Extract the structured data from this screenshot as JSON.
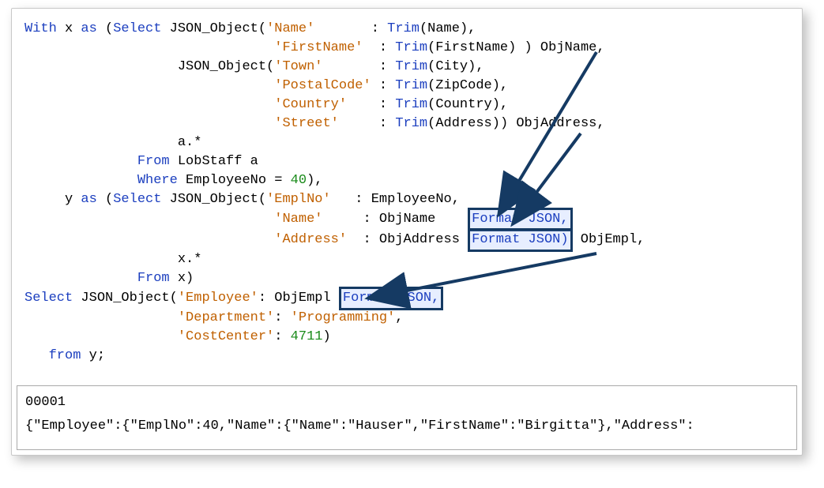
{
  "code": {
    "lines": [
      [
        {
          "c": "kw",
          "t": "With"
        },
        {
          "c": "txt",
          "t": " x "
        },
        {
          "c": "kw",
          "t": "as"
        },
        {
          "c": "txt",
          "t": " ("
        },
        {
          "c": "kw",
          "t": "Select"
        },
        {
          "c": "txt",
          "t": " JSON_Object("
        },
        {
          "c": "str",
          "t": "'Name'"
        },
        {
          "c": "txt",
          "t": "       : "
        },
        {
          "c": "kw",
          "t": "Trim"
        },
        {
          "c": "txt",
          "t": "(Name),"
        }
      ],
      [
        {
          "c": "txt",
          "t": "                               "
        },
        {
          "c": "str",
          "t": "'FirstName'"
        },
        {
          "c": "txt",
          "t": "  : "
        },
        {
          "c": "kw",
          "t": "Trim"
        },
        {
          "c": "txt",
          "t": "(FirstName) ) ObjName,"
        }
      ],
      [
        {
          "c": "txt",
          "t": "                   JSON_Object("
        },
        {
          "c": "str",
          "t": "'Town'"
        },
        {
          "c": "txt",
          "t": "       : "
        },
        {
          "c": "kw",
          "t": "Trim"
        },
        {
          "c": "txt",
          "t": "(City),"
        }
      ],
      [
        {
          "c": "txt",
          "t": "                               "
        },
        {
          "c": "str",
          "t": "'PostalCode'"
        },
        {
          "c": "txt",
          "t": " : "
        },
        {
          "c": "kw",
          "t": "Trim"
        },
        {
          "c": "txt",
          "t": "(ZipCode),"
        }
      ],
      [
        {
          "c": "txt",
          "t": "                               "
        },
        {
          "c": "str",
          "t": "'Country'"
        },
        {
          "c": "txt",
          "t": "    : "
        },
        {
          "c": "kw",
          "t": "Trim"
        },
        {
          "c": "txt",
          "t": "(Country),"
        }
      ],
      [
        {
          "c": "txt",
          "t": "                               "
        },
        {
          "c": "str",
          "t": "'Street'"
        },
        {
          "c": "txt",
          "t": "     : "
        },
        {
          "c": "kw",
          "t": "Trim"
        },
        {
          "c": "txt",
          "t": "(Address)) ObjAddress,"
        }
      ],
      [
        {
          "c": "txt",
          "t": "                   a.*"
        }
      ],
      [
        {
          "c": "txt",
          "t": "              "
        },
        {
          "c": "kw",
          "t": "From"
        },
        {
          "c": "txt",
          "t": " LobStaff a"
        }
      ],
      [
        {
          "c": "txt",
          "t": "              "
        },
        {
          "c": "kw",
          "t": "Where"
        },
        {
          "c": "txt",
          "t": " EmployeeNo = "
        },
        {
          "c": "num",
          "t": "40"
        },
        {
          "c": "txt",
          "t": "),"
        }
      ],
      [
        {
          "c": "txt",
          "t": "     y "
        },
        {
          "c": "kw",
          "t": "as"
        },
        {
          "c": "txt",
          "t": " ("
        },
        {
          "c": "kw",
          "t": "Select"
        },
        {
          "c": "txt",
          "t": " JSON_Object("
        },
        {
          "c": "str",
          "t": "'EmplNo'"
        },
        {
          "c": "txt",
          "t": "   : EmployeeNo,"
        }
      ],
      [
        {
          "c": "txt",
          "t": "                               "
        },
        {
          "c": "str",
          "t": "'Name'"
        },
        {
          "c": "txt",
          "t": "     : ObjName    "
        },
        {
          "c": "box",
          "t": ""
        }
      ],
      [
        {
          "c": "txt",
          "t": "                               "
        },
        {
          "c": "str",
          "t": "'Address'"
        },
        {
          "c": "txt",
          "t": "  : ObjAddress "
        },
        {
          "c": "box",
          "t": ""
        },
        {
          "c": "txt",
          "t": " ObjEmpl,"
        }
      ],
      [
        {
          "c": "txt",
          "t": "                   x.*"
        }
      ],
      [
        {
          "c": "txt",
          "t": "              "
        },
        {
          "c": "kw",
          "t": "From"
        },
        {
          "c": "txt",
          "t": " x)"
        }
      ],
      [
        {
          "c": "kw",
          "t": "Select"
        },
        {
          "c": "txt",
          "t": " JSON_Object("
        },
        {
          "c": "str",
          "t": "'Employee'"
        },
        {
          "c": "txt",
          "t": ": ObjEmpl "
        },
        {
          "c": "box",
          "t": ""
        }
      ],
      [
        {
          "c": "txt",
          "t": "                   "
        },
        {
          "c": "str",
          "t": "'Department'"
        },
        {
          "c": "txt",
          "t": ": "
        },
        {
          "c": "str",
          "t": "'Programming'"
        },
        {
          "c": "txt",
          "t": ","
        }
      ],
      [
        {
          "c": "txt",
          "t": "                   "
        },
        {
          "c": "str",
          "t": "'CostCenter'"
        },
        {
          "c": "txt",
          "t": ": "
        },
        {
          "c": "num",
          "t": "4711"
        },
        {
          "c": "txt",
          "t": ")"
        }
      ],
      [
        {
          "c": "txt",
          "t": "   "
        },
        {
          "c": "kw",
          "t": "from"
        },
        {
          "c": "txt",
          "t": " y;"
        }
      ]
    ],
    "box_labels": {
      "fmt_json_comma": "Format JSON,",
      "fmt_json_paren": "Format JSON)"
    }
  },
  "output": {
    "l1": "00001",
    "l2": "{\"Employee\":{\"EmplNo\":40,\"Name\":{\"Name\":\"Hauser\",\"FirstName\":\"Birgitta\"},\"Address\":"
  }
}
